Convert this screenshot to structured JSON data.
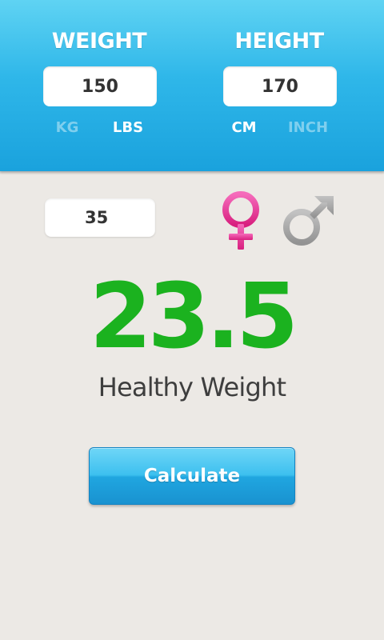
{
  "weight": {
    "title": "WEIGHT",
    "value": "150",
    "units": [
      "KG",
      "LBS"
    ],
    "selected_unit": "LBS"
  },
  "height": {
    "title": "HEIGHT",
    "value": "170",
    "units": [
      "CM",
      "INCH"
    ],
    "selected_unit": "CM"
  },
  "age": {
    "value": "35"
  },
  "gender": {
    "options": [
      "female",
      "male"
    ],
    "selected": "female",
    "female_color": "#e9379c",
    "male_color": "#a4a4a4",
    "female_icon": "female-symbol-icon",
    "male_icon": "male-symbol-icon"
  },
  "result": {
    "bmi": "23.5",
    "status": "Healthy Weight",
    "color": "#1bb21f"
  },
  "actions": {
    "calculate_label": "Calculate"
  },
  "colors": {
    "header": "#2fb7e9",
    "background": "#ece9e5",
    "button": "#20a6e0"
  }
}
